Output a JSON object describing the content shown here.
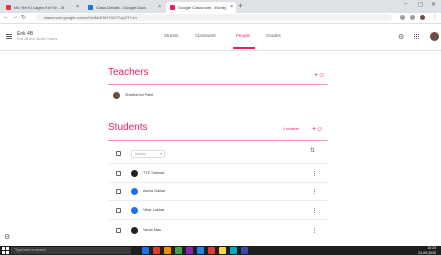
{
  "browser": {
    "tabs": [
      {
        "title": "Mo Teri Ki Lagen Kiri Sir - Jit",
        "favicon_color": "#e53935",
        "active": false
      },
      {
        "title": "Class Details - Google Docs",
        "favicon_color": "#1a73e8",
        "active": false
      },
      {
        "title": "Google Classroom - Ekmbj",
        "favicon_color": "#e91e63",
        "active": true
      }
    ],
    "new_tab": "+",
    "window_controls": [
      "–",
      "▢",
      "✕"
    ],
    "url": "classroom.google.com/u/0/c/MzE5NTI0OTUyOTYz/r"
  },
  "header": {
    "menu_icon": "hamburger-icon",
    "class_title": "Enk 4B",
    "class_subtitle": "Enk 4B and Studio Teams",
    "tabs": [
      "Stream",
      "Classwork",
      "People",
      "Grades"
    ],
    "selected_tab": "People",
    "accent": "#e91e63"
  },
  "teachers": {
    "title": "Teachers",
    "list": [
      {
        "name": "Shaileshmi Patel",
        "avatar_color": "#6d4c41"
      }
    ]
  },
  "students": {
    "title": "Students",
    "count_label": "4 students",
    "actions_label": "Actions",
    "list": [
      {
        "name": "TTE Sabnad",
        "avatar_color": "#212121"
      },
      {
        "name": "Aarna Gaikar",
        "avatar_color": "#1a73e8"
      },
      {
        "name": "Vikar Lakhar",
        "avatar_color": "#1a73e8"
      },
      {
        "name": "Vanta Mas",
        "avatar_color": "#212121"
      }
    ]
  },
  "taskbar": {
    "search_placeholder": "Type here to search",
    "time": "10:24",
    "date": "24-09-2020",
    "apps": [
      "#1a73e8",
      "#e53935",
      "#fb8c00",
      "#43a047",
      "#8e24aa",
      "#1e88e5",
      "#e53935",
      "#fdd835",
      "#00acc1",
      "#3949ab"
    ]
  }
}
